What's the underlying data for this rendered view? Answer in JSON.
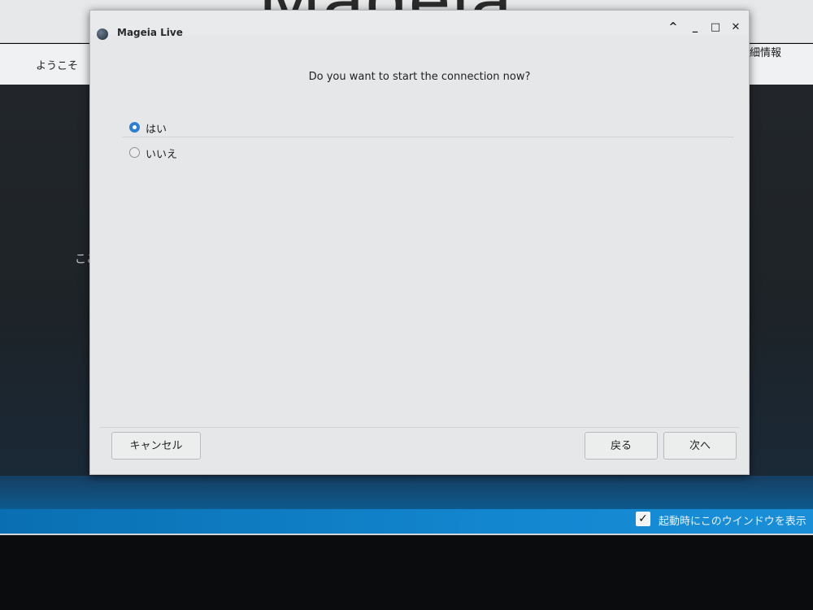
{
  "background_app": {
    "logo_text": "Mageia",
    "tab_left": "ようこそ",
    "tab_right": "細情報",
    "main_text": "ここ",
    "footer_checkbox_label": "起動時にこのウインドウを表示",
    "footer_checkbox_mark": "✓"
  },
  "dialog": {
    "title": "Mageia Live",
    "window_buttons": {
      "up": "^",
      "minimize": "_",
      "maximize": "□",
      "close": "✕"
    },
    "question": "Do you want to start the connection now?",
    "options": [
      {
        "label": "はい",
        "selected": true
      },
      {
        "label": "いいえ",
        "selected": false
      }
    ],
    "buttons": {
      "cancel": "キャンセル",
      "back": "戻る",
      "next": "次へ"
    }
  },
  "colors": {
    "accent": "#2f7fd1",
    "footer_blue": "#1286cf"
  }
}
